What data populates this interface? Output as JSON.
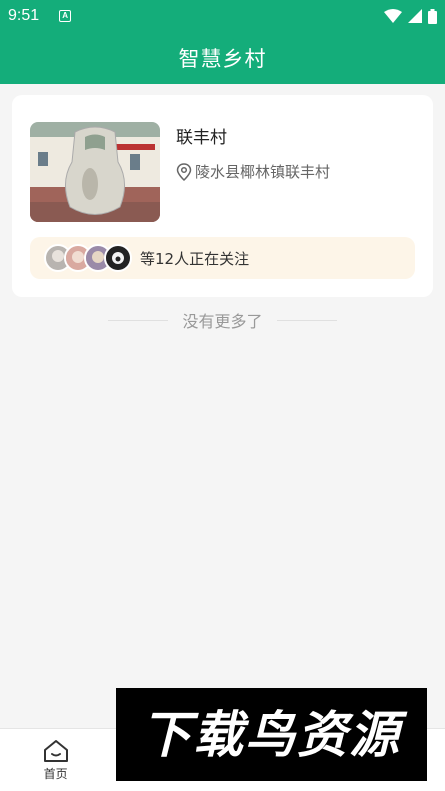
{
  "status": {
    "time": "9:51",
    "app_icon_letter": "A"
  },
  "header": {
    "title": "智慧乡村"
  },
  "village": {
    "name": "联丰村",
    "location": "陵水县椰林镇联丰村",
    "follow_text": "等12人正在关注"
  },
  "list_end": {
    "text": "没有更多了"
  },
  "tabs": [
    {
      "label": "首页",
      "icon": "home-icon"
    },
    {
      "label": "",
      "icon": ""
    },
    {
      "label": "",
      "icon": ""
    },
    {
      "label": "",
      "icon": ""
    }
  ],
  "watermark": {
    "text": "下载鸟资源"
  },
  "colors": {
    "brand": "#14ad7a",
    "follow_bg": "#fdf5e8",
    "background": "#f5f5f5"
  }
}
